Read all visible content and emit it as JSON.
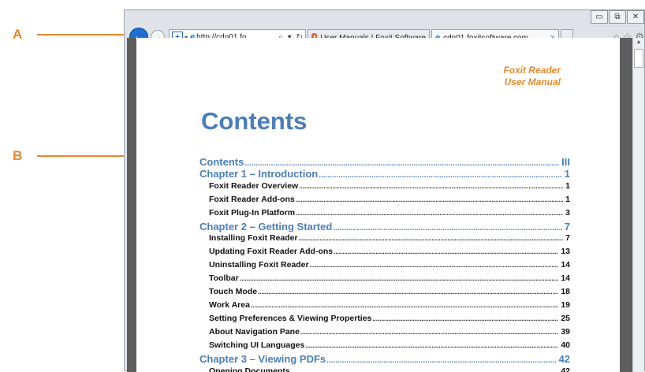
{
  "callouts": {
    "a": "A",
    "b": "B"
  },
  "window_controls": {
    "minimize": "▭",
    "restore": "⧉",
    "close": "✕"
  },
  "browser": {
    "back_icon": "back-arrow-icon",
    "forward_icon": "forward-arrow-icon",
    "address": {
      "site_icon": "+",
      "dropdown": "▾",
      "url": "http://cdn01.fo...",
      "search_icon": "⌕",
      "search_dd": "▾",
      "refresh_icon": "↻"
    },
    "tabs": [
      {
        "label": "User Manuals | Foxit Software",
        "icon": "foxit-icon"
      },
      {
        "label": "cdn01.foxitsoftware.com",
        "icon": "ie-icon",
        "close": "×"
      }
    ],
    "right_icons": {
      "home": "⌂",
      "favorites": "☆",
      "settings": "⚙"
    }
  },
  "document": {
    "header_line1": "Foxit Reader",
    "header_line2": "User Manual",
    "title": "Contents",
    "toc": [
      {
        "type": "chapter",
        "label": "Contents",
        "page": "III"
      },
      {
        "type": "chapter",
        "label": "Chapter 1 – Introduction",
        "page": "1"
      },
      {
        "type": "section",
        "label": "Foxit Reader Overview",
        "page": "1"
      },
      {
        "type": "section",
        "label": "Foxit Reader Add-ons",
        "page": "1"
      },
      {
        "type": "section",
        "label": "Foxit Plug-In Platform",
        "page": "3"
      },
      {
        "type": "chapter",
        "label": "Chapter 2 – Getting Started",
        "page": "7"
      },
      {
        "type": "section",
        "label": "Installing Foxit Reader",
        "page": "7"
      },
      {
        "type": "section",
        "label": "Updating Foxit Reader Add-ons",
        "page": "13"
      },
      {
        "type": "section",
        "label": "Uninstalling Foxit Reader",
        "page": "14"
      },
      {
        "type": "section",
        "label": "Toolbar",
        "page": "14"
      },
      {
        "type": "section",
        "label": "Touch Mode",
        "page": "18"
      },
      {
        "type": "section",
        "label": "Work Area",
        "page": "19"
      },
      {
        "type": "section",
        "label": "Setting Preferences & Viewing Properties",
        "page": "25"
      },
      {
        "type": "section",
        "label": "About Navigation Pane",
        "page": "39"
      },
      {
        "type": "section",
        "label": "Switching UI Languages",
        "page": "40"
      },
      {
        "type": "chapter",
        "label": "Chapter 3 – Viewing PDFs",
        "page": "42"
      },
      {
        "type": "section",
        "label": "Opening Documents",
        "page": "42"
      }
    ]
  }
}
